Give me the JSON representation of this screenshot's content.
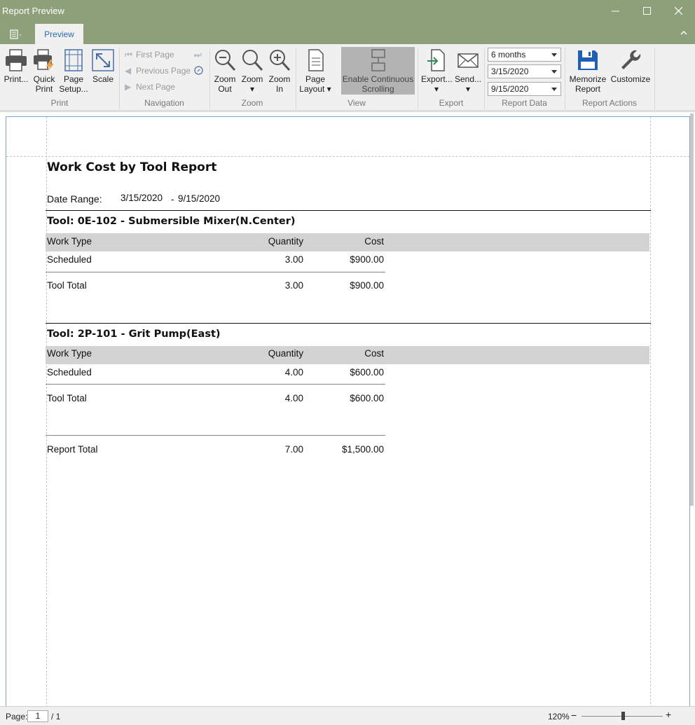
{
  "window": {
    "title": "Report Preview"
  },
  "tabs": {
    "preview": "Preview"
  },
  "ribbon": {
    "print": {
      "print": "Print...",
      "quick_print_1": "Quick",
      "quick_print_2": "Print",
      "page_setup_1": "Page",
      "page_setup_2": "Setup...",
      "scale": "Scale",
      "group": "Print"
    },
    "navigation": {
      "first_page": "First Page",
      "previous_page": "Previous Page",
      "next_page": "Next Page",
      "group": "Navigation"
    },
    "zoom": {
      "zoom_out_1": "Zoom",
      "zoom_out_2": "Out",
      "zoom": "Zoom",
      "zoom_in_1": "Zoom",
      "zoom_in_2": "In",
      "group": "Zoom"
    },
    "page_layout": {
      "line1": "Page",
      "line2": "Layout"
    },
    "view": {
      "cont_1": "Enable Continuous",
      "cont_2": "Scrolling",
      "group": "View"
    },
    "export": {
      "export": "Export...",
      "send": "Send...",
      "group": "Export"
    },
    "report_data": {
      "period": "6 months",
      "start_date": "3/15/2020",
      "end_date": "9/15/2020",
      "group": "Report Data"
    },
    "report_actions": {
      "memorize_1": "Memorize",
      "memorize_2": "Report",
      "customize": "Customize",
      "group": "Report Actions"
    }
  },
  "report": {
    "title": "Work Cost by Tool Report",
    "date_range_label": "Date Range:",
    "date_from": "3/15/2020",
    "date_sep": "-",
    "date_to": "9/15/2020",
    "columns": {
      "work_type": "Work Type",
      "quantity": "Quantity",
      "cost": "Cost"
    },
    "tools": [
      {
        "header": "Tool: 0E-102 - Submersible Mixer(N.Center)",
        "row_type": "Scheduled",
        "row_qty": "3.00",
        "row_cost": "$900.00",
        "total_label": "Tool Total",
        "total_qty": "3.00",
        "total_cost": "$900.00"
      },
      {
        "header": "Tool: 2P-101 - Grit Pump(East)",
        "row_type": "Scheduled",
        "row_qty": "4.00",
        "row_cost": "$600.00",
        "total_label": "Tool Total",
        "total_qty": "4.00",
        "total_cost": "$600.00"
      }
    ],
    "report_total": {
      "label": "Report Total",
      "qty": "7.00",
      "cost": "$1,500.00"
    }
  },
  "status": {
    "page_label": "Page:",
    "page_value": "1",
    "page_total": "/ 1",
    "zoom": "120%",
    "zoom_level_percent": 120
  },
  "icons": [
    "app-menu-icon",
    "minimize-icon",
    "maximize-icon",
    "close-icon",
    "collapse-ribbon-icon",
    "printer-icon",
    "quick-print-icon",
    "page-setup-icon",
    "scale-icon",
    "first-page-icon",
    "previous-page-icon",
    "next-page-icon",
    "last-page-icon",
    "go-to-page-icon",
    "zoom-out-icon",
    "zoom-icon",
    "zoom-in-icon",
    "page-layout-icon",
    "continuous-scrolling-icon",
    "export-icon",
    "send-email-icon",
    "save-disk-icon",
    "wrench-icon"
  ]
}
